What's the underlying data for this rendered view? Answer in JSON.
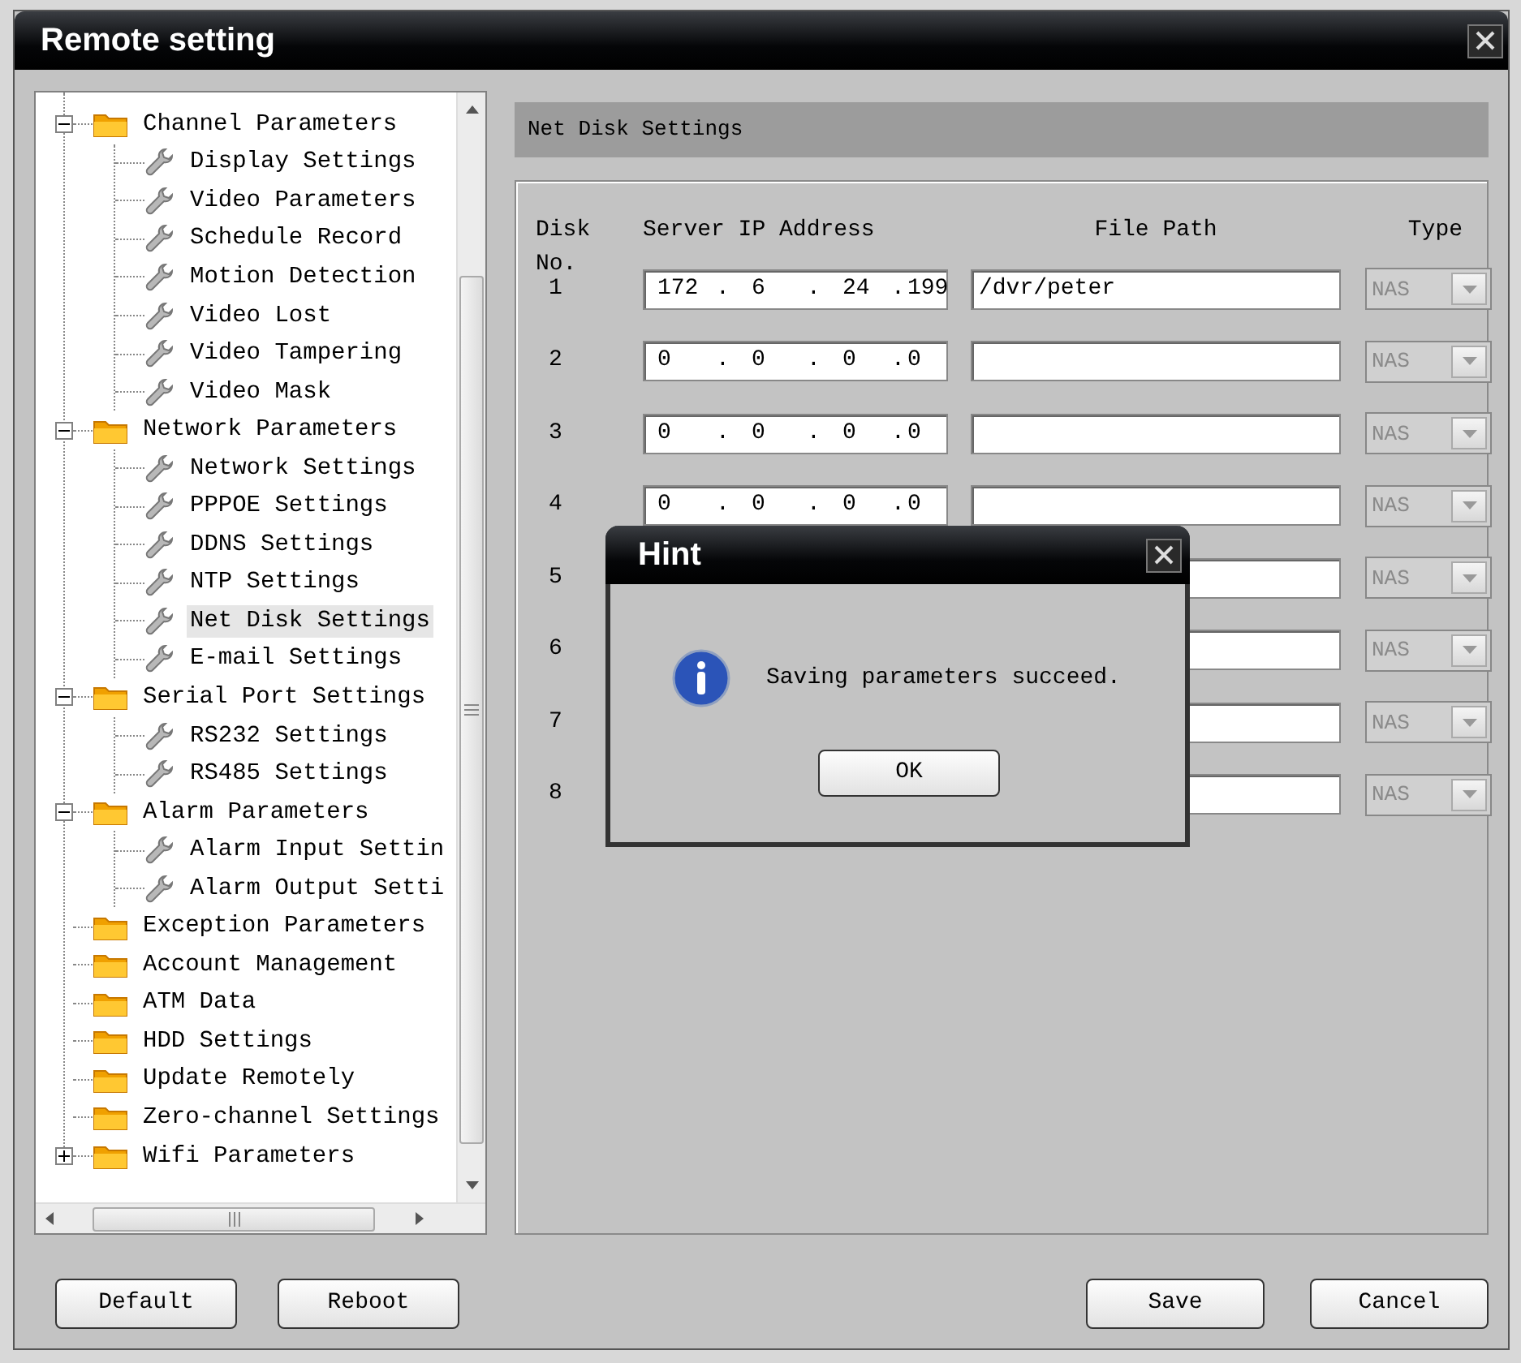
{
  "window": {
    "title": "Remote setting"
  },
  "tree": [
    {
      "label": "Channel Parameters",
      "expanded": true,
      "children": [
        {
          "label": "Display Settings",
          "selected": false
        },
        {
          "label": "Video Parameters",
          "selected": false
        },
        {
          "label": "Schedule Record",
          "selected": false
        },
        {
          "label": "Motion Detection",
          "selected": false
        },
        {
          "label": "Video Lost",
          "selected": false
        },
        {
          "label": "Video Tampering",
          "selected": false
        },
        {
          "label": "Video Mask",
          "selected": false
        }
      ]
    },
    {
      "label": "Network Parameters",
      "expanded": true,
      "children": [
        {
          "label": "Network Settings",
          "selected": false
        },
        {
          "label": "PPPOE Settings",
          "selected": false
        },
        {
          "label": "DDNS Settings",
          "selected": false
        },
        {
          "label": "NTP Settings",
          "selected": false
        },
        {
          "label": "Net Disk Settings",
          "selected": true
        },
        {
          "label": "E-mail Settings",
          "selected": false
        }
      ]
    },
    {
      "label": "Serial Port Settings",
      "expanded": true,
      "children": [
        {
          "label": "RS232 Settings",
          "selected": false
        },
        {
          "label": "RS485 Settings",
          "selected": false
        }
      ]
    },
    {
      "label": "Alarm Parameters",
      "expanded": true,
      "children": [
        {
          "label": "Alarm Input Settin",
          "selected": false
        },
        {
          "label": "Alarm Output Setti",
          "selected": false
        }
      ]
    },
    {
      "label": "Exception Parameters"
    },
    {
      "label": "Account Management"
    },
    {
      "label": "ATM Data"
    },
    {
      "label": "HDD Settings"
    },
    {
      "label": "Update Remotely"
    },
    {
      "label": "Zero-channel Settings"
    },
    {
      "label": "Wifi Parameters",
      "expanded": false
    }
  ],
  "panel": {
    "title": "Net Disk Settings"
  },
  "table": {
    "columns": [
      "Disk No.",
      "Server IP Address",
      "File Path",
      "Type"
    ],
    "rows": [
      {
        "disk": "1",
        "ip": [
          "172",
          ".",
          "6",
          ".",
          "24",
          ".",
          "199"
        ],
        "path": "/dvr/peter",
        "type": "NAS",
        "disabled": true
      },
      {
        "disk": "2",
        "ip": [
          "0",
          ".",
          "0",
          ".",
          "0",
          ".",
          "0"
        ],
        "type": "NAS",
        "disabled": true
      },
      {
        "disk": "3",
        "ip": [
          "0",
          ".",
          "0",
          ".",
          "0",
          ".",
          "0"
        ],
        "type": "NAS",
        "disabled": true
      },
      {
        "disk": "4",
        "ip": [
          "0",
          ".",
          "0",
          ".",
          "0",
          ".",
          "0"
        ],
        "type": "NAS",
        "disabled": true
      },
      {
        "disk": "5",
        "type": "NAS",
        "disabled": true
      },
      {
        "disk": "6",
        "type": "NAS",
        "disabled": true
      },
      {
        "disk": "7",
        "type": "NAS",
        "disabled": true
      },
      {
        "disk": "8",
        "type": "NAS",
        "disabled": true
      }
    ]
  },
  "buttons_left": [
    "Default",
    "Reboot"
  ],
  "buttons_right": [
    "Save",
    "Cancel"
  ],
  "dialog": {
    "title": "Hint",
    "message": "Saving parameters succeed.",
    "button": "OK"
  }
}
